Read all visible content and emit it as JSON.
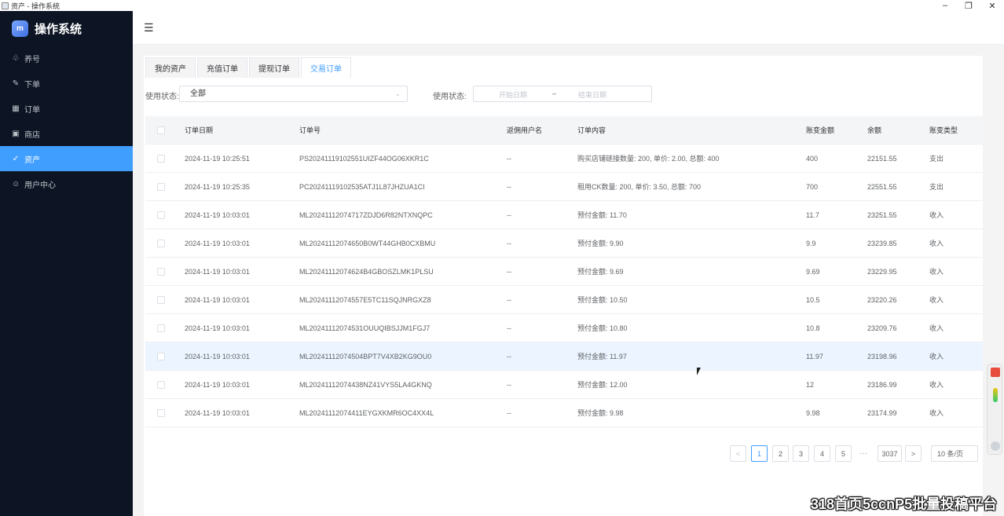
{
  "window": {
    "title": "资产 - 操作系统",
    "controls": [
      "–",
      "❐",
      "✕"
    ]
  },
  "sidebar": {
    "brand": {
      "logo_text": "m",
      "title": "操作系统"
    },
    "items": [
      {
        "label": "养号",
        "icon": "users-icon",
        "glyph": "♧"
      },
      {
        "label": "下单",
        "icon": "edit-icon",
        "glyph": "✎"
      },
      {
        "label": "订单",
        "icon": "grid-icon",
        "glyph": "▦"
      },
      {
        "label": "商店",
        "icon": "store-icon",
        "glyph": "▣"
      },
      {
        "label": "资产",
        "icon": "check-circle-icon",
        "glyph": "✓",
        "active": true
      },
      {
        "label": "用户中心",
        "icon": "user-icon",
        "glyph": "☺"
      }
    ]
  },
  "header": {
    "collapse_glyph": "☰"
  },
  "tabs": [
    {
      "label": "我的资产"
    },
    {
      "label": "充值订单"
    },
    {
      "label": "提现订单"
    },
    {
      "label": "交易订单",
      "active": true
    }
  ],
  "filters": {
    "status_label_1": "使用状态:",
    "status_value": "全部",
    "status_label_2": "使用状态:",
    "date_start_placeholder": "开始日期",
    "date_separator": "–",
    "date_end_placeholder": "结束日期"
  },
  "table": {
    "columns": [
      "订单日期",
      "订单号",
      "返佣用户名",
      "订单内容",
      "账变金额",
      "余额",
      "账变类型"
    ],
    "rows": [
      [
        "2024-11-19 10:25:51",
        "PS20241119102551UIZF44OG06XKR1C",
        "--",
        "购买店铺链接数量: 200, 单价: 2.00, 总额: 400",
        "400",
        "22151.55",
        "支出"
      ],
      [
        "2024-11-19 10:25:35",
        "PC20241119102535ATJ1L87JHZUA1CI",
        "--",
        "租用CK数量: 200, 单价: 3.50, 总额: 700",
        "700",
        "22551.55",
        "支出"
      ],
      [
        "2024-11-19 10:03:01",
        "ML20241112074717ZDJD6R82NTXNQPC",
        "--",
        "预付金额: 11.70",
        "11.7",
        "23251.55",
        "收入"
      ],
      [
        "2024-11-19 10:03:01",
        "ML20241112074650B0WT44GHB0CXBMU",
        "--",
        "预付金额: 9.90",
        "9.9",
        "23239.85",
        "收入"
      ],
      [
        "2024-11-19 10:03:01",
        "ML20241112074624B4GBOSZLMK1PLSU",
        "--",
        "预付金额: 9.69",
        "9.69",
        "23229.95",
        "收入"
      ],
      [
        "2024-11-19 10:03:01",
        "ML20241112074557E5TC11SQJNRGXZ8",
        "--",
        "预付金额: 10.50",
        "10.5",
        "23220.26",
        "收入"
      ],
      [
        "2024-11-19 10:03:01",
        "ML20241112074531OUUQIBSJJM1FGJ7",
        "--",
        "预付金额: 10.80",
        "10.8",
        "23209.76",
        "收入"
      ],
      [
        "2024-11-19 10:03:01",
        "ML20241112074504BPT7V4XB2KG9OU0",
        "--",
        "预付金额: 11.97",
        "11.97",
        "23198.96",
        "收入"
      ],
      [
        "2024-11-19 10:03:01",
        "ML20241112074438NZ41VYS5LA4GKNQ",
        "--",
        "预付金额: 12.00",
        "12",
        "23186.99",
        "收入"
      ],
      [
        "2024-11-19 10:03:01",
        "ML20241112074411EYGXKMR6OC4XX4L",
        "--",
        "预付金额: 9.98",
        "9.98",
        "23174.99",
        "收入"
      ]
    ]
  },
  "pagination": {
    "prev": "<",
    "pages": [
      "1",
      "2",
      "3",
      "4",
      "5"
    ],
    "current": "1",
    "ellipsis": "···",
    "last": "3037",
    "next": ">",
    "page_size": "10 条/页"
  },
  "watermark": "318首页5ccnP5批量投稿平台",
  "colors": {
    "accent": "#409eff",
    "sidebar_bg": "#0d1524",
    "row_highlight": "#ecf5ff"
  }
}
